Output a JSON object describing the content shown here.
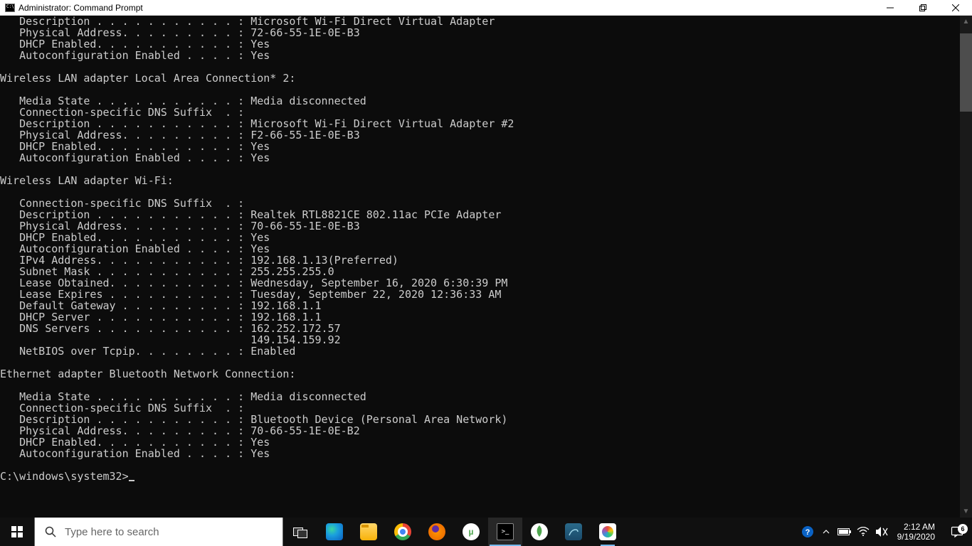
{
  "window": {
    "title": "Administrator: Command Prompt"
  },
  "console": {
    "lines": [
      "   Description . . . . . . . . . . . : Microsoft Wi-Fi Direct Virtual Adapter",
      "   Physical Address. . . . . . . . . : 72-66-55-1E-0E-B3",
      "   DHCP Enabled. . . . . . . . . . . : Yes",
      "   Autoconfiguration Enabled . . . . : Yes",
      "",
      "Wireless LAN adapter Local Area Connection* 2:",
      "",
      "   Media State . . . . . . . . . . . : Media disconnected",
      "   Connection-specific DNS Suffix  . :",
      "   Description . . . . . . . . . . . : Microsoft Wi-Fi Direct Virtual Adapter #2",
      "   Physical Address. . . . . . . . . : F2-66-55-1E-0E-B3",
      "   DHCP Enabled. . . . . . . . . . . : Yes",
      "   Autoconfiguration Enabled . . . . : Yes",
      "",
      "Wireless LAN adapter Wi-Fi:",
      "",
      "   Connection-specific DNS Suffix  . :",
      "   Description . . . . . . . . . . . : Realtek RTL8821CE 802.11ac PCIe Adapter",
      "   Physical Address. . . . . . . . . : 70-66-55-1E-0E-B3",
      "   DHCP Enabled. . . . . . . . . . . : Yes",
      "   Autoconfiguration Enabled . . . . : Yes",
      "   IPv4 Address. . . . . . . . . . . : 192.168.1.13(Preferred)",
      "   Subnet Mask . . . . . . . . . . . : 255.255.255.0",
      "   Lease Obtained. . . . . . . . . . : Wednesday, September 16, 2020 6:30:39 PM",
      "   Lease Expires . . . . . . . . . . : Tuesday, September 22, 2020 12:36:33 AM",
      "   Default Gateway . . . . . . . . . : 192.168.1.1",
      "   DHCP Server . . . . . . . . . . . : 192.168.1.1",
      "   DNS Servers . . . . . . . . . . . : 162.252.172.57",
      "                                       149.154.159.92",
      "   NetBIOS over Tcpip. . . . . . . . : Enabled",
      "",
      "Ethernet adapter Bluetooth Network Connection:",
      "",
      "   Media State . . . . . . . . . . . : Media disconnected",
      "   Connection-specific DNS Suffix  . :",
      "   Description . . . . . . . . . . . : Bluetooth Device (Personal Area Network)",
      "   Physical Address. . . . . . . . . : 70-66-55-1E-0E-B2",
      "   DHCP Enabled. . . . . . . . . . . : Yes",
      "   Autoconfiguration Enabled . . . . : Yes",
      ""
    ],
    "prompt": "C:\\windows\\system32>"
  },
  "taskbar": {
    "search_placeholder": "Type here to search",
    "apps": [
      {
        "name": "task-view",
        "label": "Task View"
      },
      {
        "name": "edge",
        "label": "Microsoft Edge"
      },
      {
        "name": "file-explorer",
        "label": "File Explorer"
      },
      {
        "name": "chrome",
        "label": "Google Chrome"
      },
      {
        "name": "firefox",
        "label": "Firefox"
      },
      {
        "name": "utorrent",
        "label": "uTorrent"
      },
      {
        "name": "command-prompt",
        "label": "Command Prompt",
        "active": true
      },
      {
        "name": "mongodb-compass",
        "label": "MongoDB Compass"
      },
      {
        "name": "mysql-workbench",
        "label": "MySQL Workbench"
      },
      {
        "name": "paint",
        "label": "Paint",
        "running": true
      }
    ],
    "tray": {
      "time": "2:12 AM",
      "date": "9/19/2020",
      "notifications_count": "6"
    }
  }
}
